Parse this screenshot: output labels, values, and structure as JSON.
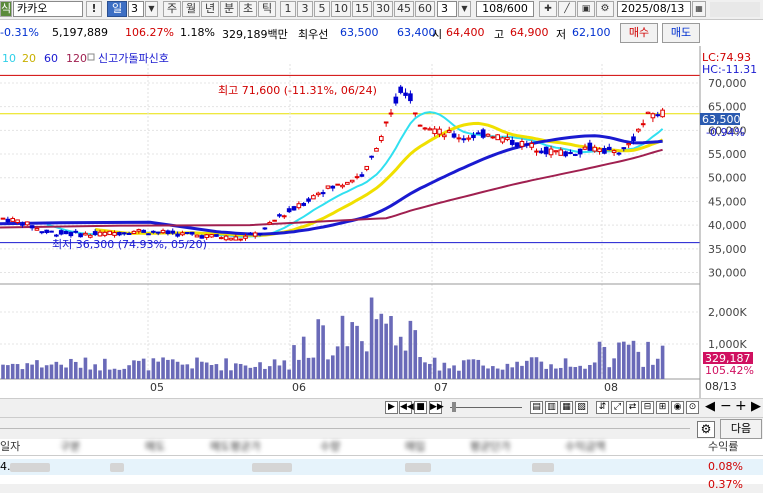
{
  "toolbar": {
    "code_prefix": "식",
    "stock_name": "카카오",
    "alert_icon": "!",
    "period_selected": "일",
    "period_count": "3",
    "periods": [
      "주",
      "월",
      "년",
      "분",
      "초",
      "틱"
    ],
    "minute_options": [
      "1",
      "3",
      "5",
      "10",
      "15",
      "30",
      "45",
      "60"
    ],
    "interval_value": "3",
    "page_counter": "108/600",
    "date": "2025/08/13"
  },
  "quote": {
    "change_pct": "-0.31%",
    "volume": "5,197,889",
    "volume_ratio": "106.27%",
    "turnover_rate": "1.18%",
    "amount": "329,189백만",
    "bid_label": "최우선",
    "best_ask": "63,500",
    "best_bid": "63,400",
    "open_label": "시",
    "open": "64,400",
    "high_label": "고",
    "high": "64,900",
    "low_label": "저",
    "low": "62,100",
    "buy_button": "매수",
    "sell_button": "매도"
  },
  "legend": {
    "ma": [
      {
        "label": "10",
        "color": "#30d0e8"
      },
      {
        "label": "20",
        "color": "#e8d000"
      },
      {
        "label": "60",
        "color": "#1a1ad0"
      },
      {
        "label": "120",
        "color": "#a02050"
      }
    ],
    "signal_label": "신고가돌파신호"
  },
  "chart_data": {
    "type": "candlestick",
    "y_ticks": [
      "70,000",
      "65,000",
      "60,000",
      "55,000",
      "50,000",
      "45,000",
      "40,000",
      "35,000",
      "30,000"
    ],
    "ylim": [
      28000,
      74000
    ],
    "volume_ticks": [
      "2,000K",
      "1,000K"
    ],
    "x_ticks": [
      "05",
      "06",
      "07",
      "08"
    ],
    "end_date_label": "08/13",
    "current_price": "63,500",
    "current_change": "-0.94%",
    "current_volume": "329,187",
    "current_volume_ratio": "105.42%",
    "lc": "LC:74.93",
    "hc": "HC:-11.31",
    "high_annotation": "최고 71,600 (-11.31%, 06/24)",
    "low_annotation": "최저 36,300 (74.93%, 05/20)",
    "high_line": 71600,
    "low_line": 36300,
    "yellow_line": 63500
  },
  "analysis_tabs": {
    "next_button": "다음"
  },
  "table": {
    "headers": [
      "일자",
      "구분",
      "매도",
      "매도평균가",
      "수량",
      "매입",
      "평균단가",
      "수익금액",
      "수익률"
    ],
    "rows": [
      {
        "first": "4.",
        "rate": "0.08%"
      },
      {
        "first": "",
        "rate": "0.37%"
      }
    ]
  }
}
